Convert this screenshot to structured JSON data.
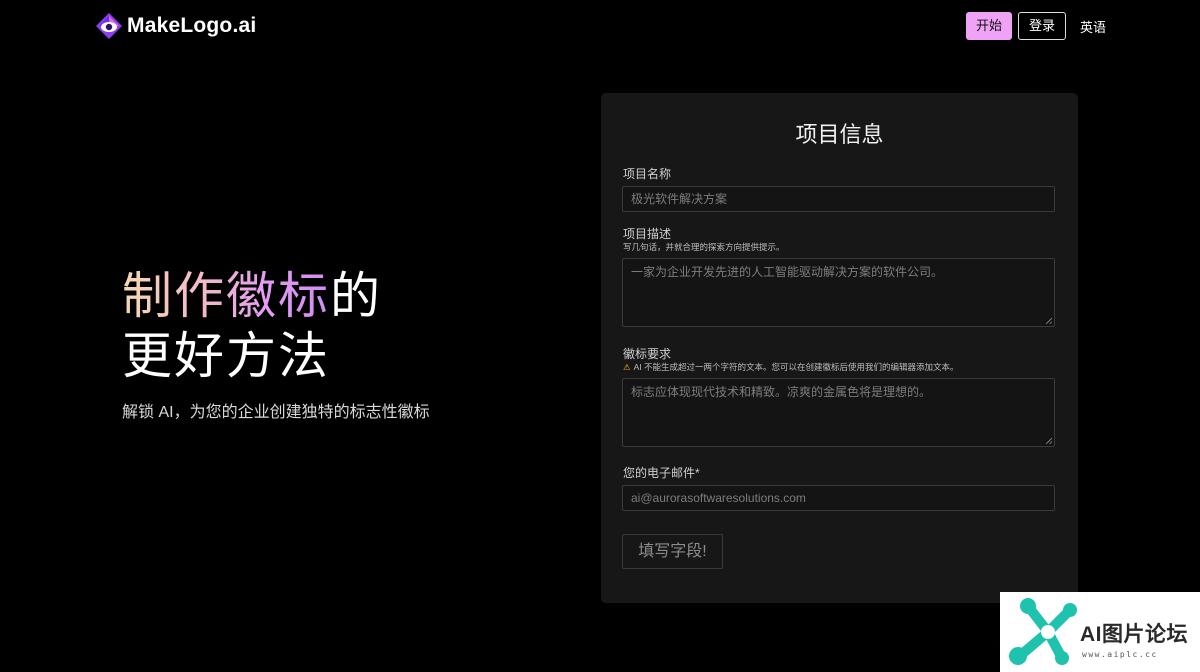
{
  "header": {
    "logo_text": "MakeLogo.ai",
    "nav": {
      "start": "开始",
      "login": "登录",
      "language": "英语"
    }
  },
  "hero": {
    "title_highlight": "制作徽标",
    "title_rest_line1": "的",
    "title_line2": "更好方法",
    "subtitle": "解锁 AI，为您的企业创建独特的标志性徽标"
  },
  "form": {
    "title": "项目信息",
    "project_name": {
      "label": "项目名称",
      "placeholder": "极光软件解决方案"
    },
    "project_description": {
      "label": "项目描述",
      "hint": "写几句话，并就合理的探索方向提供提示。",
      "placeholder": "一家为企业开发先进的人工智能驱动解决方案的软件公司。"
    },
    "logo_requirements": {
      "label": "徽标要求",
      "hint": "AI 不能生成超过一两个字符的文本。您可以在创建徽标后使用我们的编辑器添加文本。",
      "placeholder": "标志应体现现代技术和精致。凉爽的金属色将是理想的。"
    },
    "email": {
      "label": "您的电子邮件*",
      "placeholder": "ai@aurorasoftwaresolutions.com"
    },
    "submit": "填写字段!"
  },
  "watermark": {
    "title": "AI图片论坛",
    "url": "www.aiplc.cc"
  },
  "colors": {
    "accent": "#f0a2f7",
    "panel_bg": "#171717",
    "warning": "#e6b422",
    "watermark_teal": "#1fc2ad"
  },
  "icons": {
    "logo": "eye-diamond-logo-icon",
    "warning": "warning-triangle-icon",
    "watermark": "molecule-logo-icon"
  }
}
